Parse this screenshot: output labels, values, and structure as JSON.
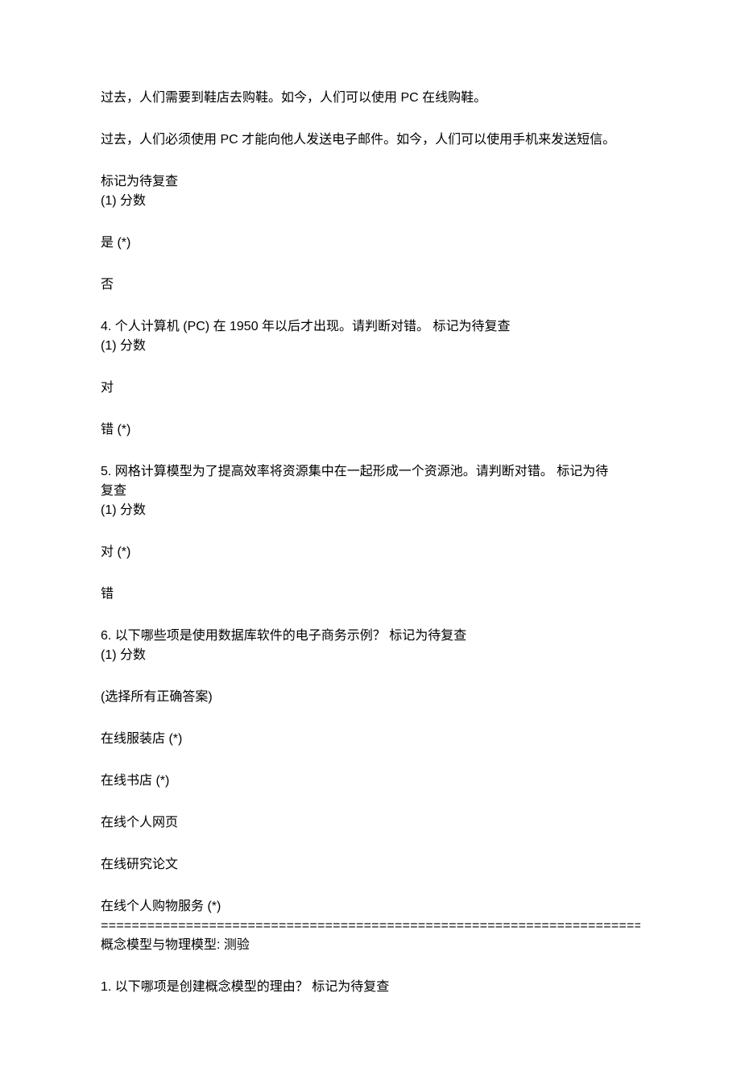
{
  "intro": {
    "p1": "过去，人们需要到鞋店去购鞋。如今，人们可以使用 PC 在线购鞋。",
    "p2": "过去，人们必须使用 PC 才能向他人发送电子邮件。如今，人们可以使用手机来发送短信。"
  },
  "q3_tail": {
    "mark": "标记为待复查",
    "score": "(1) 分数",
    "opt1": "是 (*)",
    "opt2": "否"
  },
  "q4": {
    "text": "4. 个人计算机 (PC) 在 1950 年以后才出现。请判断对错。 标记为待复查",
    "score": "(1) 分数",
    "opt1": "对",
    "opt2": "错 (*)"
  },
  "q5": {
    "text_l1": "5. 网格计算模型为了提高效率将资源集中在一起形成一个资源池。请判断对错。 标记为待",
    "text_l2": "复查",
    "score": "(1) 分数",
    "opt1": "对 (*)",
    "opt2": "错"
  },
  "q6": {
    "text": "6. 以下哪些项是使用数据库软件的电子商务示例？ 标记为待复查",
    "score": "(1) 分数",
    "hint": "(选择所有正确答案)",
    "opt1": "在线服装店 (*)",
    "opt2": "在线书店 (*)",
    "opt3": "在线个人网页",
    "opt4": "在线研究论文",
    "opt5": "在线个人购物服务 (*)"
  },
  "divider": "==========================================================================",
  "section2": {
    "title": "概念模型与物理模型: 测验",
    "q1": "1. 以下哪项是创建概念模型的理由？ 标记为待复查"
  }
}
